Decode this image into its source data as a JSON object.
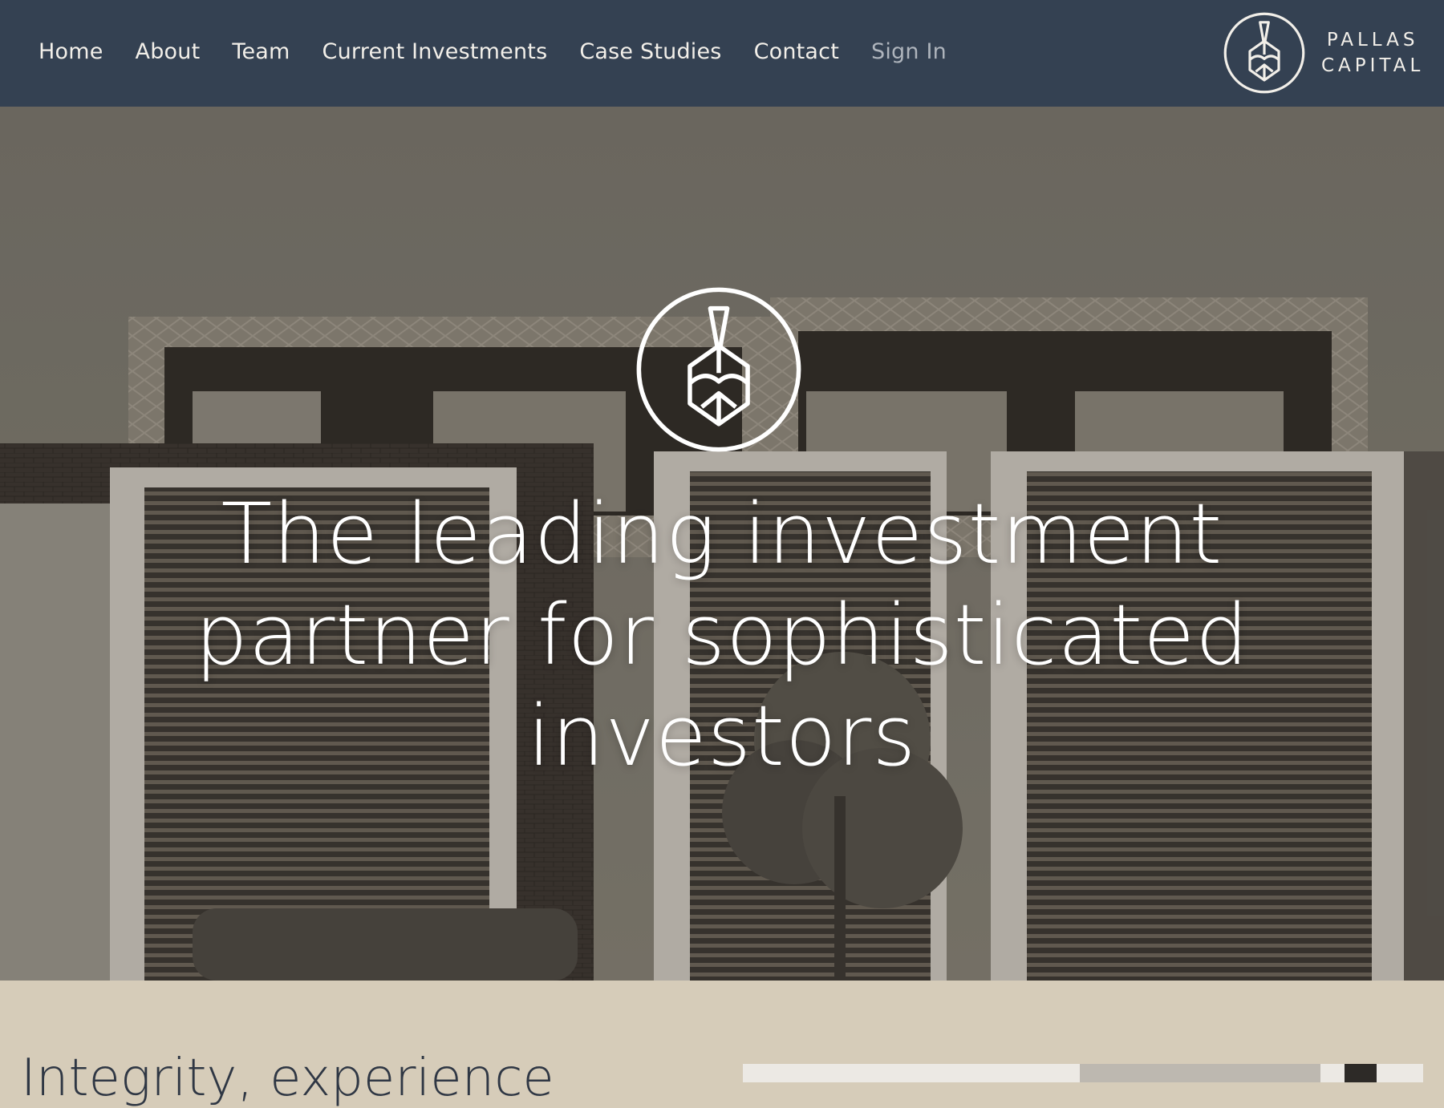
{
  "nav": {
    "links": [
      {
        "label": "Home"
      },
      {
        "label": "About"
      },
      {
        "label": "Team"
      },
      {
        "label": "Current Investments"
      },
      {
        "label": "Case Studies"
      },
      {
        "label": "Contact"
      },
      {
        "label": "Sign In"
      }
    ]
  },
  "brand": {
    "line1": "PALLAS",
    "line2": "CAPITAL",
    "icon": "pallas-helmet-icon"
  },
  "hero": {
    "headline": "The leading investment partner for sophisticated investors",
    "image": "townhouse-facade-photo"
  },
  "intro": {
    "heading": "Integrity, experience"
  },
  "colors": {
    "nav_bg": "#344152",
    "nav_text": "#f2efe9",
    "nav_muted": "#aeb4bc",
    "section_bg": "#d6ccb9",
    "heading_text": "#2f3744"
  }
}
